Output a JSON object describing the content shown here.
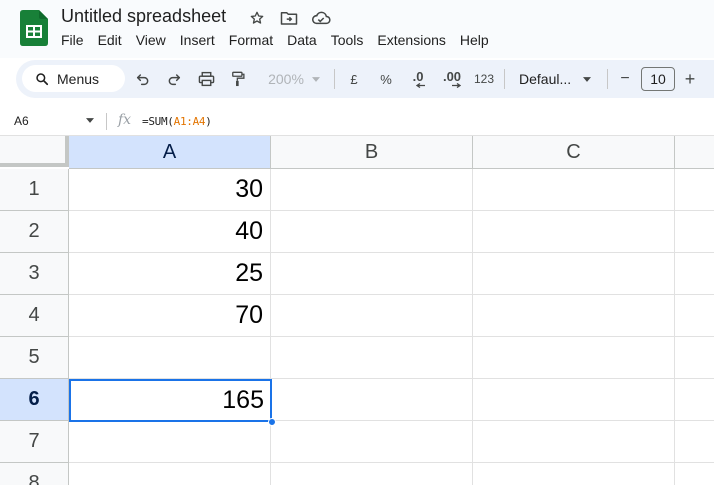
{
  "app": {
    "doc_title": "Untitled spreadsheet",
    "brand_color": "#188038",
    "accent_color": "#1a73e8"
  },
  "menu": [
    "File",
    "Edit",
    "View",
    "Insert",
    "Format",
    "Data",
    "Tools",
    "Extensions",
    "Help"
  ],
  "toolbar": {
    "search_label": "Menus",
    "zoom": "200%",
    "currency": "£",
    "percent": "%",
    "decrease_decimal": ".0",
    "increase_decimal": ".00",
    "number_format": "123",
    "font": "Defaul...",
    "font_size": "10",
    "minus": "−",
    "plus": "+"
  },
  "formula_bar": {
    "name_box": "A6",
    "fx": "fx",
    "formula_prefix": "=SUM(",
    "formula_range": "A1:A4",
    "formula_suffix": ")"
  },
  "grid": {
    "columns": [
      "A",
      "B",
      "C"
    ],
    "rows": [
      "1",
      "2",
      "3",
      "4",
      "5",
      "6",
      "7",
      "8"
    ],
    "cells": {
      "A1": "30",
      "A2": "40",
      "A3": "25",
      "A4": "70",
      "A6": "165"
    },
    "active_cell": "A6"
  }
}
